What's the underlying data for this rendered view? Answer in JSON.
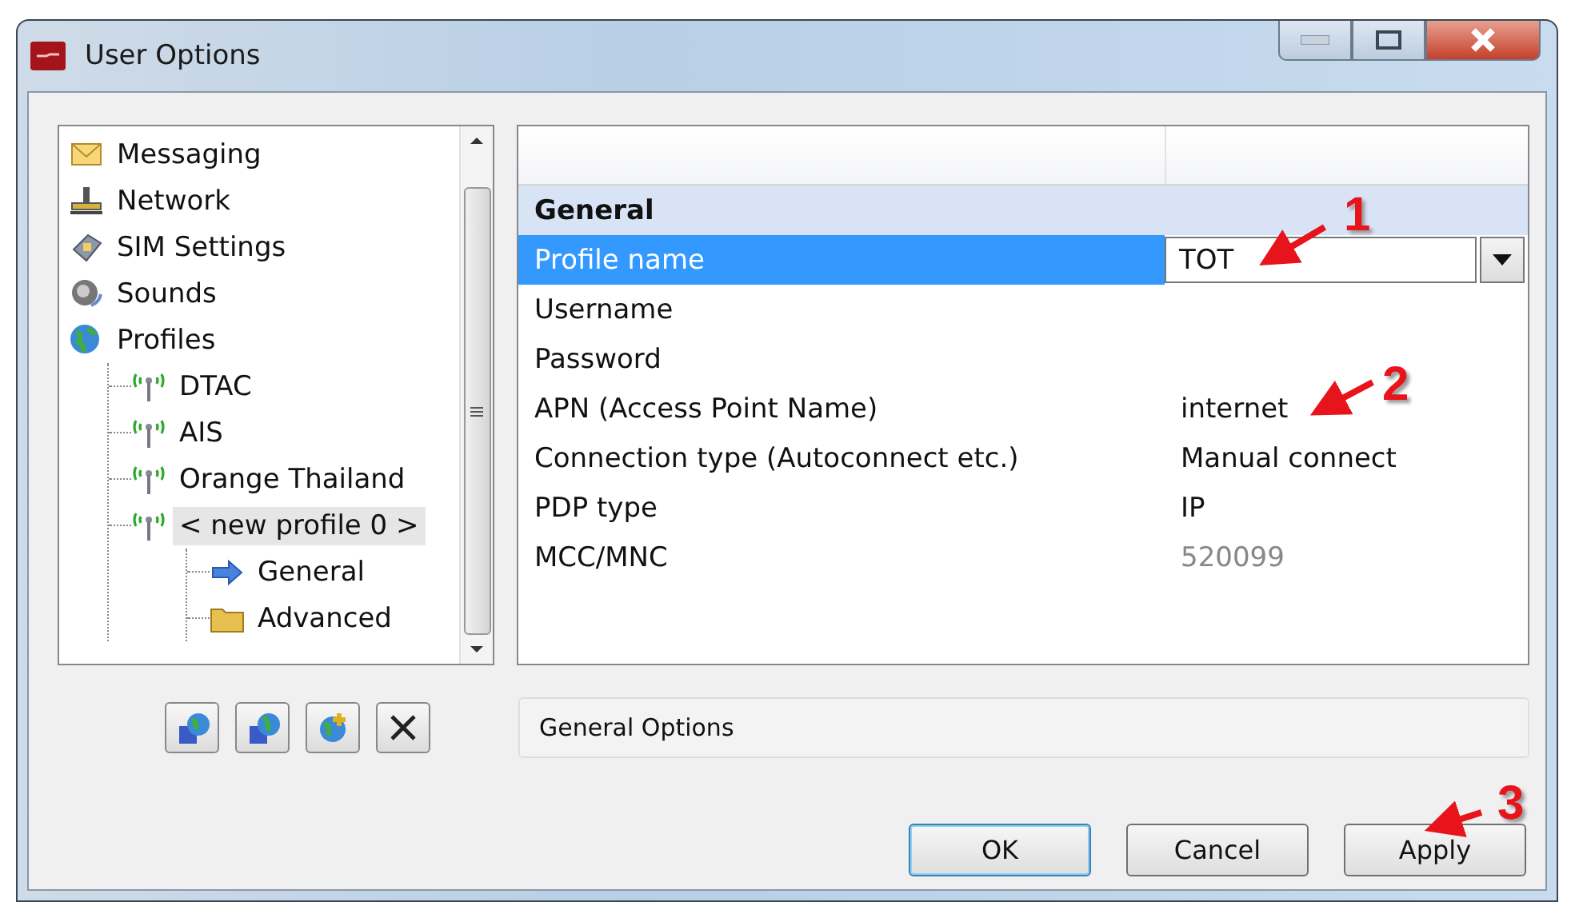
{
  "window": {
    "title": "User Options"
  },
  "tree": [
    {
      "label": "Messaging",
      "kind": "envelope",
      "selected": false
    },
    {
      "label": "Network",
      "kind": "network",
      "selected": false
    },
    {
      "label": "SIM Settings",
      "kind": "sim",
      "selected": false
    },
    {
      "label": "Sounds",
      "kind": "speaker",
      "selected": false
    },
    {
      "label": "Profiles",
      "kind": "globe",
      "selected": false,
      "children": [
        {
          "label": "DTAC",
          "kind": "antenna",
          "selected": false
        },
        {
          "label": "AIS",
          "kind": "antenna",
          "selected": false
        },
        {
          "label": "Orange Thailand",
          "kind": "antenna",
          "selected": false
        },
        {
          "label": "< new profile 0 >",
          "kind": "antenna",
          "selected": true,
          "children": [
            {
              "label": "General",
              "kind": "arrow",
              "selected": false
            },
            {
              "label": "Advanced",
              "kind": "folder",
              "selected": false
            }
          ]
        }
      ]
    }
  ],
  "properties": [
    {
      "kind": "category",
      "name": "General"
    },
    {
      "kind": "combo",
      "name": "Profile name",
      "value": "TOT",
      "selected": true
    },
    {
      "kind": "text",
      "name": "Username",
      "selected": false
    },
    {
      "kind": "text",
      "name": "Password",
      "selected": false
    },
    {
      "kind": "text",
      "name": "APN (Access Point Name)",
      "value": "internet",
      "selected": false
    },
    {
      "kind": "text",
      "name": "Connection type (Autoconnect etc.)",
      "value": "Manual connect",
      "selected": false
    },
    {
      "kind": "text",
      "name": "PDP type",
      "value": "IP",
      "selected": false
    },
    {
      "kind": "text",
      "name": "MCC/MNC",
      "value": "520099",
      "selected": false,
      "disabled": true
    }
  ],
  "description": "General Options",
  "buttons": [
    {
      "label": "OK",
      "default": true
    },
    {
      "label": "Cancel",
      "default": false
    },
    {
      "label": "Apply",
      "default": false
    }
  ],
  "annotations": [
    "1",
    "2",
    "3"
  ]
}
